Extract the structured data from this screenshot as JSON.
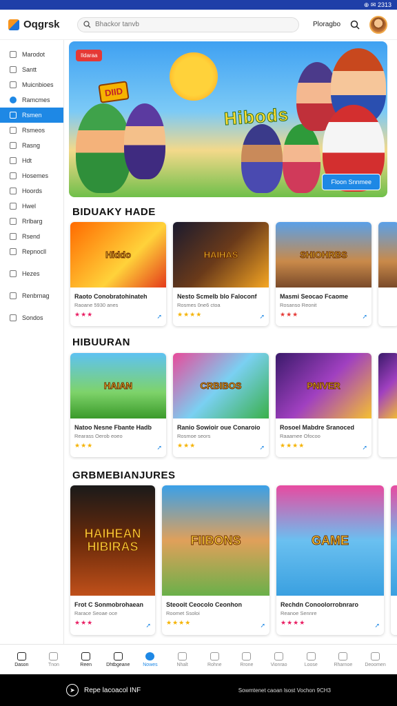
{
  "statusbar": {
    "icons": "⊕ ✉ 2313"
  },
  "app": {
    "title": "Oqgrsk",
    "search_placeholder": "Bhackor tanvb",
    "profile_label": "Ploragbo"
  },
  "sidebar": {
    "items": [
      {
        "label": "Marodot",
        "icon": "home-icon"
      },
      {
        "label": "Santt",
        "icon": "grid-icon"
      },
      {
        "label": "Muicnbioes",
        "icon": "list-icon"
      },
      {
        "label": "Ramcmes",
        "icon": "check-icon",
        "check": true
      },
      {
        "label": "Rsmen",
        "icon": "folder-icon",
        "active": true
      },
      {
        "label": "Rsmeos",
        "icon": "page-icon"
      },
      {
        "label": "Rasng",
        "icon": "page-icon"
      },
      {
        "label": "Hdt",
        "icon": "page-icon"
      },
      {
        "label": "Hosemes",
        "icon": "page-icon"
      },
      {
        "label": "Hoords",
        "icon": "page-icon"
      },
      {
        "label": "Hwel",
        "icon": "page-icon"
      },
      {
        "label": "Rrlbarg",
        "icon": "page-icon"
      },
      {
        "label": "Rsend",
        "icon": "page-icon"
      },
      {
        "label": "Repnocll",
        "icon": "page-icon"
      },
      {
        "label": "Hezes",
        "icon": "gear-icon"
      },
      {
        "label": "Renbrnag",
        "icon": "gear-icon"
      },
      {
        "label": "Sondos",
        "icon": "gear-icon"
      }
    ]
  },
  "hero": {
    "badge": "Ildaraa",
    "sign": "DIID",
    "title": "Hibods",
    "cta": "Floon Snnmee"
  },
  "sections": [
    {
      "title": "BIDUAKY HADE",
      "cards": [
        {
          "thumb": "Hiddo",
          "title": "Raoto Conobratohinateh",
          "sub": "Raoane 5930 anes",
          "rating": "★★★",
          "rating_color": "#e91e63"
        },
        {
          "thumb": "HAIHAS",
          "title": "Nesto Scmelb blo Faloconf",
          "sub": "Rosmes 0ne6 ctoa",
          "rating": "★★★★",
          "rating_color": "#f5b301"
        },
        {
          "thumb": "SHIOHRBS",
          "title": "Masmi Seocao Fcaome",
          "sub": "Rosanso Reonit",
          "rating": "★★★",
          "rating_color": "#e53935"
        }
      ]
    },
    {
      "title": "HIBUURAN",
      "cards": [
        {
          "thumb": "HAIAN",
          "title": "Natoo Nesne Fbante Hadb",
          "sub": "Rearass Oerob eoeo",
          "rating": "★★★",
          "rating_color": "#f5b301"
        },
        {
          "thumb": "CRBIBOS",
          "title": "Ranio Sowioir oue Conaroio",
          "sub": "Rosmoe seors",
          "rating": "★★★",
          "rating_color": "#f5b301"
        },
        {
          "thumb": "PNIVER",
          "title": "Rosoel Mabdre Sranoced",
          "sub": "Raaamee Ofocoo",
          "rating": "★★★★",
          "rating_color": "#f5b301"
        }
      ]
    },
    {
      "title": "GRBMEBIANJURES",
      "cards": [
        {
          "thumb": "HAIHEAN HIBIRAS",
          "title": "Frot C Sonmobrohaean",
          "sub": "Rarace Seoae oce",
          "rating": "★★★",
          "rating_color": "#e91e63"
        },
        {
          "thumb": "FIIBONS",
          "title": "Steooit Ceocolo Ceonhon",
          "sub": "Roomet Ssoloi",
          "rating": "★★★★",
          "rating_color": "#f5b301"
        },
        {
          "thumb": "GAME",
          "title": "Rechdn Conoolorrobnraro",
          "sub": "Reanoe Sennre",
          "rating": "★★★★",
          "rating_color": "#e91e63"
        }
      ]
    }
  ],
  "bottomnav": [
    {
      "label": "Dason",
      "dark": true
    },
    {
      "label": "Tnon"
    },
    {
      "label": "Reen",
      "dark": true
    },
    {
      "label": "Dhtbgeane",
      "dark": true
    },
    {
      "label": "Nowes",
      "active": true
    },
    {
      "label": "Nhalt"
    },
    {
      "label": "Rohne"
    },
    {
      "label": "Rrone"
    },
    {
      "label": "Vionrao"
    },
    {
      "label": "Loose"
    },
    {
      "label": "Rharnoe"
    },
    {
      "label": "Deoomen"
    }
  ],
  "footer": {
    "left": "Repe lacoacol INF",
    "right": "Sowmtenet caoan lsost Vochon 9CH3"
  }
}
